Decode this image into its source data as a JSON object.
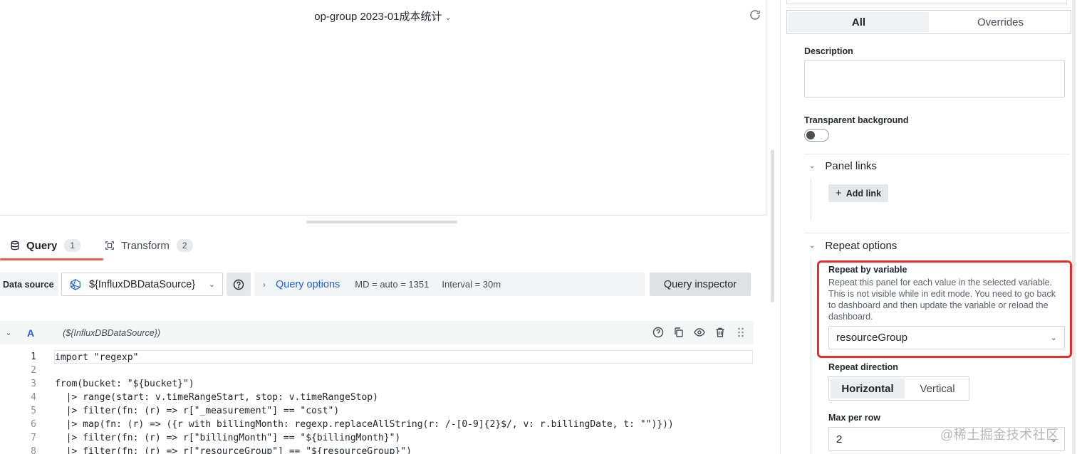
{
  "panel": {
    "title": "op-group 2023-01成本统计",
    "title_chevron": "⌄"
  },
  "tabs": [
    {
      "label": "Query",
      "count": "1",
      "active": true
    },
    {
      "label": "Transform",
      "count": "2",
      "active": false
    }
  ],
  "toolbar": {
    "data_source_label": "Data source",
    "data_source_value": "${InfluxDBDataSource}",
    "query_options_label": "Query options",
    "md": "MD = auto = 1351",
    "interval": "Interval = 30m",
    "inspector_label": "Query inspector"
  },
  "query_row": {
    "ref_id": "A",
    "datasource": "(${InfluxDBDataSource})"
  },
  "editor": {
    "lines": [
      {
        "n": "1",
        "text": "import \"regexp\""
      },
      {
        "n": "2",
        "text": ""
      },
      {
        "n": "3",
        "text": "from(bucket: \"${bucket}\")"
      },
      {
        "n": "4",
        "text": "  |> range(start: v.timeRangeStart, stop: v.timeRangeStop)"
      },
      {
        "n": "5",
        "text": "  |> filter(fn: (r) => r[\"_measurement\"] == \"cost\")"
      },
      {
        "n": "6",
        "text": "  |> map(fn: (r) => ({r with billingMonth: regexp.replaceAllString(r: /-[0-9]{2}$/, v: r.billingDate, t: \"\")}))"
      },
      {
        "n": "7",
        "text": "  |> filter(fn: (r) => r[\"billingMonth\"] == \"${billingMonth}\")"
      },
      {
        "n": "8",
        "text": "  |> filter(fn: (r) => r[\"resourceGroup\"] == \"${resourceGroup}\")"
      }
    ]
  },
  "options": {
    "seg_all": "All",
    "seg_overrides": "Overrides",
    "description_label": "Description",
    "transparent_label": "Transparent background",
    "panel_links_label": "Panel links",
    "add_link_label": "Add link",
    "repeat_options_label": "Repeat options",
    "repeat_by_label": "Repeat by variable",
    "repeat_by_desc": "Repeat this panel for each value in the selected variable. This is not visible while in edit mode. You need to go back to dashboard and then update the variable or reload the dashboard.",
    "repeat_by_value": "resourceGroup",
    "repeat_dir_label": "Repeat direction",
    "dir_horizontal": "Horizontal",
    "dir_vertical": "Vertical",
    "max_per_row_label": "Max per row",
    "max_per_row_value": "2"
  },
  "watermark": "@稀土掘金技术社区",
  "colors": {
    "accent": "#1f62e0",
    "tab_underline": "#f05a4a",
    "highlight": "#e2302c"
  }
}
